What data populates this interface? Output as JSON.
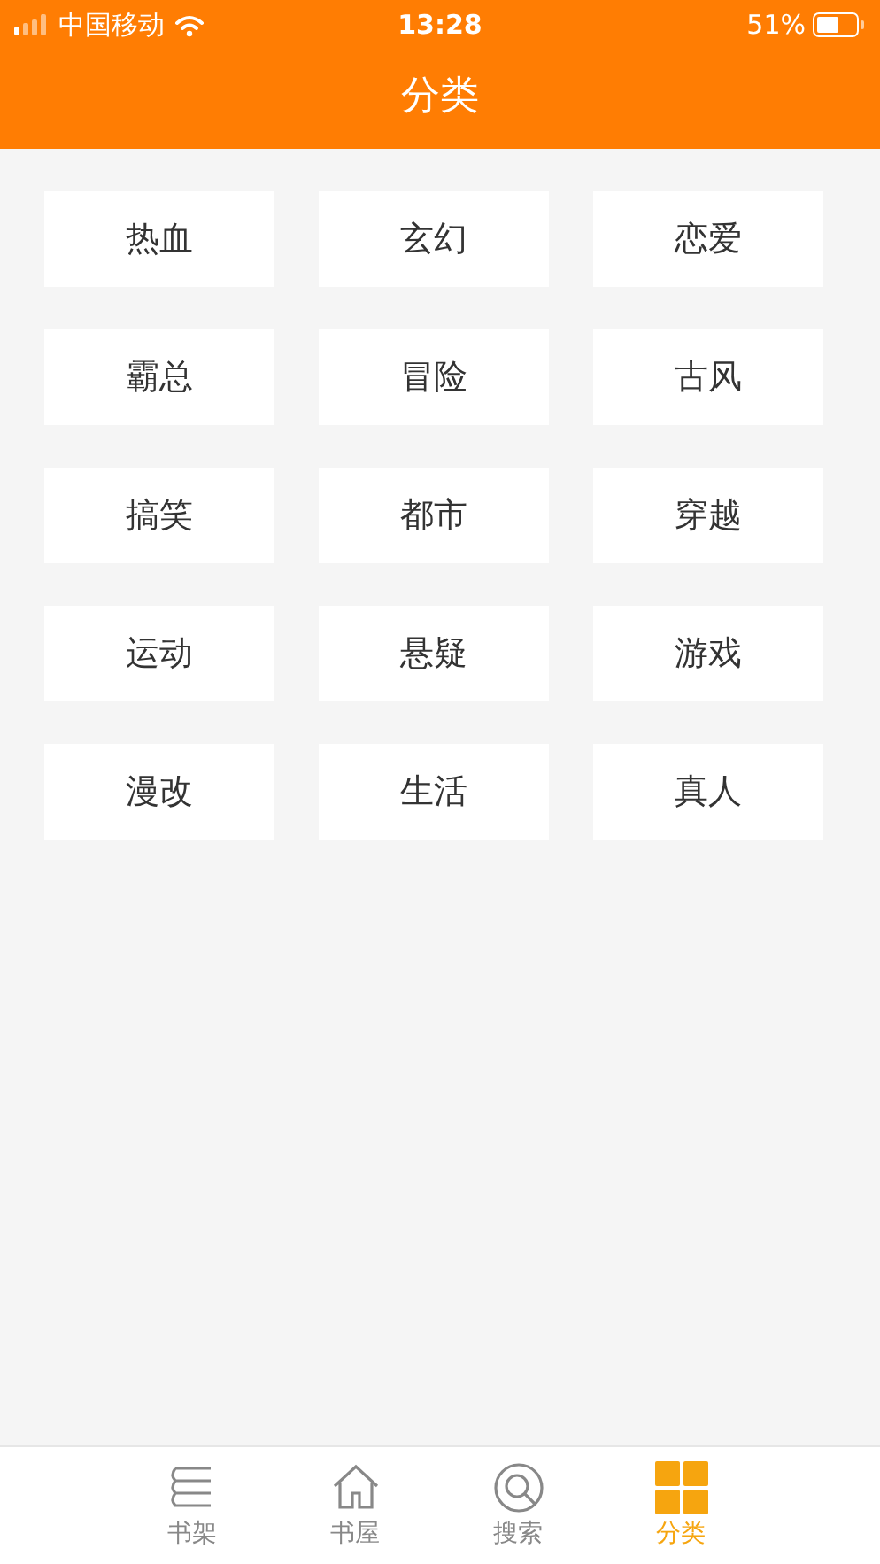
{
  "status_bar": {
    "carrier": "中国移动",
    "time": "13:28",
    "battery": "51%"
  },
  "nav": {
    "title": "分类"
  },
  "categories": [
    {
      "label": "热血"
    },
    {
      "label": "玄幻"
    },
    {
      "label": "恋爱"
    },
    {
      "label": "霸总"
    },
    {
      "label": "冒险"
    },
    {
      "label": "古风"
    },
    {
      "label": "搞笑"
    },
    {
      "label": "都市"
    },
    {
      "label": "穿越"
    },
    {
      "label": "运动"
    },
    {
      "label": "悬疑"
    },
    {
      "label": "游戏"
    },
    {
      "label": "漫改"
    },
    {
      "label": "生活"
    },
    {
      "label": "真人"
    }
  ],
  "tab_bar": [
    {
      "label": "书架",
      "kind": "shelf",
      "selected": false
    },
    {
      "label": "书屋",
      "kind": "house",
      "selected": false
    },
    {
      "label": "搜索",
      "kind": "search",
      "selected": false
    },
    {
      "label": "分类",
      "kind": "grid",
      "selected": true
    }
  ]
}
